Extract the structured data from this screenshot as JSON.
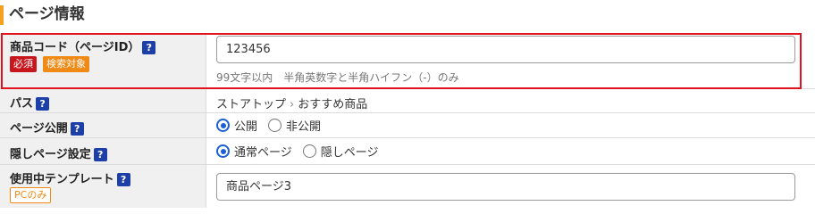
{
  "section": {
    "title": "ページ情報"
  },
  "fields": {
    "product_code": {
      "label": "商品コード（ページID）",
      "help": "?",
      "badge_required": "必須",
      "badge_search": "検索対象",
      "value": "123456",
      "hint": "99文字以内　半角英数字と半角ハイフン（-）のみ"
    },
    "path": {
      "label": "パス",
      "help": "?",
      "crumbs": [
        "ストアトップ",
        "おすすめ商品"
      ],
      "separator": "›"
    },
    "page_public": {
      "label": "ページ公開",
      "help": "?",
      "options": [
        "公開",
        "非公開"
      ],
      "selected": "公開"
    },
    "hidden_page": {
      "label": "隠しページ設定",
      "help": "?",
      "options": [
        "通常ページ",
        "隠しページ"
      ],
      "selected": "通常ページ"
    },
    "template": {
      "label": "使用中テンプレート",
      "help": "?",
      "badge_pc": "PCのみ",
      "value": "商品ページ3"
    }
  },
  "colors": {
    "accent_bar": "#f5a020",
    "highlight": "#e0141c",
    "help_icon": "#1d3fa8",
    "required": "#c8161d",
    "search": "#ef8a16",
    "radio": "#1d5fd6"
  }
}
